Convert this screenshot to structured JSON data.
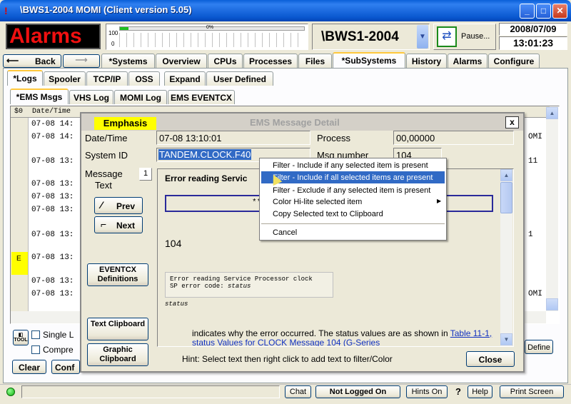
{
  "window": {
    "title": "\\BWS1-2004 MOMI (Client version 5.05)"
  },
  "header": {
    "alarms_label": "Alarms",
    "gauge_ticks": [
      "100",
      "0"
    ],
    "gauge_percent": "0%",
    "system_name": "\\BWS1-2004",
    "pause_label": "Pause...",
    "date": "2008/07/09",
    "time": "13:01:23"
  },
  "nav": {
    "back_label": "Back",
    "tabs": [
      "*Systems",
      "Overview",
      "CPUs",
      "Processes",
      "Files",
      "*SubSystems",
      "History",
      "Alarms",
      "Configure"
    ]
  },
  "subtabs": [
    "*Logs",
    "Spooler",
    "TCP/IP",
    "OSS",
    "Expand",
    "User Defined"
  ],
  "logtabs": [
    "*EMS Msgs",
    "VHS Log",
    "MOMI Log",
    "EMS EVENTCX"
  ],
  "grid": {
    "headers": [
      "$0",
      "Date/Time"
    ],
    "rows": [
      {
        "flag": "",
        "time": "07-08 14:"
      },
      {
        "flag": "",
        "time": "07-08 14:"
      },
      {
        "flag": "",
        "time": "07-08 13:"
      },
      {
        "flag": "",
        "time": "07-08 13:"
      },
      {
        "flag": "",
        "time": "07-08 13:"
      },
      {
        "flag": "",
        "time": "07-08 13:"
      },
      {
        "flag": "",
        "time": "07-08 13:"
      },
      {
        "flag": "E",
        "time": "07-08 13:"
      },
      {
        "flag": "",
        "time": "07-08 13:"
      },
      {
        "flag": "",
        "time": "07-08 13:"
      }
    ],
    "right_fragments": [
      "OMI",
      "11",
      "1",
      "OMI"
    ]
  },
  "left_controls": {
    "single_label": "Single L",
    "compress_label": "Compre",
    "clear_label": "Clear",
    "conf_label": "Conf",
    "define_label": "Define"
  },
  "dialog": {
    "emphasis": "Emphasis",
    "title": "EMS Message Detail",
    "close_x": "x",
    "date_label": "Date/Time",
    "date_value": "07-08 13:10:01",
    "process_label": "Process",
    "process_value": "00,00000",
    "sysid_label": "System ID",
    "sysid_value": "TANDEM.CLOCK.F40",
    "msgnum_label": "Msg number",
    "msgnum_value": "104",
    "message_label": "Message",
    "text_label": "Text",
    "message_index": "1",
    "prev_label": "Prev",
    "next_label": "Next",
    "eventcx_label": "EVENTCX Definitions",
    "text_clip_label": "Text Clipboard",
    "graphic_clip_label": "Graphic Clipboard",
    "body_heading": "Error reading Servic",
    "body_boxed": "**",
    "body_number": "104",
    "code_line1": "Error reading Service Processor clock",
    "code_line2_prefix": "SP error code: ",
    "code_line2_var": "status",
    "status_italic": "status",
    "para_text": "indicates why the error occurred. The status values are as shown in ",
    "para_link": "Table 11-1, status Values for CLOCK Message 104 (G-Series",
    "hint": "Hint: Select text then right click to add text to filter/Color",
    "close_label": "Close"
  },
  "context_menu": {
    "items": [
      "Filter - Include if any selected item is present",
      "Filter - Include if all selected items are present",
      "Filter - Exclude if any selected item is present",
      "Color Hi-lite selected item",
      "Copy Selected text to Clipboard",
      "Cancel"
    ]
  },
  "statusbar": {
    "chat": "Chat",
    "logged": "Not Logged On",
    "hints": "Hints On",
    "q": "?",
    "help": "Help",
    "print": "Print Screen"
  }
}
